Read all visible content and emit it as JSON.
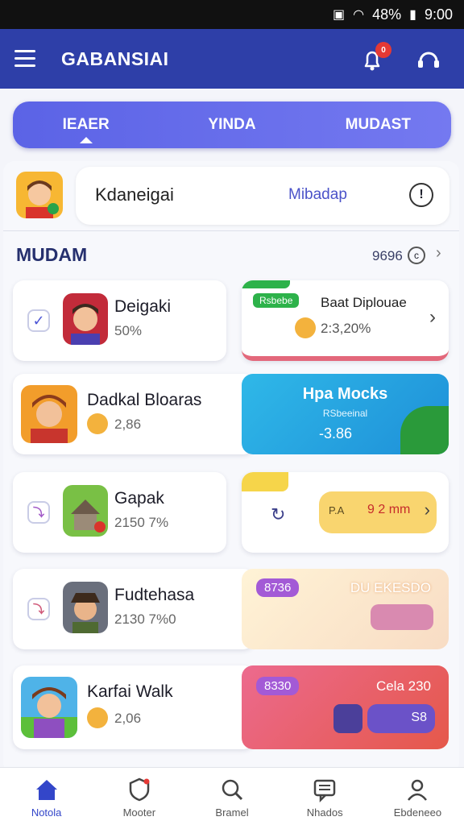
{
  "status_bar": {
    "time": "9:00",
    "battery": "48%"
  },
  "app": {
    "title": "GABANSIAI",
    "notification_count": "0"
  },
  "tabs": [
    {
      "label": "IEAER",
      "active": true
    },
    {
      "label": "YINDA",
      "active": false
    },
    {
      "label": "MUDAST",
      "active": false
    }
  ],
  "profile": {
    "name": "Kdaneigai",
    "mode": "Mibadap"
  },
  "section": {
    "title": "MUDAM",
    "count": "9696"
  },
  "games": [
    {
      "title": "Deigaki",
      "subtitle": "50%",
      "checked": true
    },
    {
      "title": "Dadkal Bloaras",
      "subtitle": "2,86"
    },
    {
      "title": "Gapak",
      "subtitle": "2150 7%"
    },
    {
      "title": "Fudtehasa",
      "subtitle": "2130 7%0"
    },
    {
      "title": "Karfai Walk",
      "subtitle": "2,06"
    }
  ],
  "promos": {
    "p1": {
      "tag": "Rsbebe",
      "title": "Baat Diplouae",
      "value": "2:3,20%"
    },
    "p2": {
      "title": "Hpa Mocks",
      "subtitle": "RSbeeinal",
      "value": "-3.86"
    },
    "p3": {
      "pill": "P.A",
      "value": "9 2 mm"
    },
    "p4": {
      "badge": "8736",
      "title": "DU EKESDO"
    },
    "p5": {
      "badge": "8330",
      "title": "Cela 230",
      "value": "S8"
    }
  },
  "bottom_nav": [
    {
      "label": "Notola",
      "icon": "home-icon",
      "active": true
    },
    {
      "label": "Mooter",
      "icon": "shield-icon"
    },
    {
      "label": "Bramel",
      "icon": "search-icon"
    },
    {
      "label": "Nhados",
      "icon": "message-icon"
    },
    {
      "label": "Ebdeneeo",
      "icon": "profile-icon"
    }
  ],
  "colors": {
    "app_bar": "#2e3fa8",
    "accent": "#5b63e6",
    "active_nav": "#3346c9"
  }
}
